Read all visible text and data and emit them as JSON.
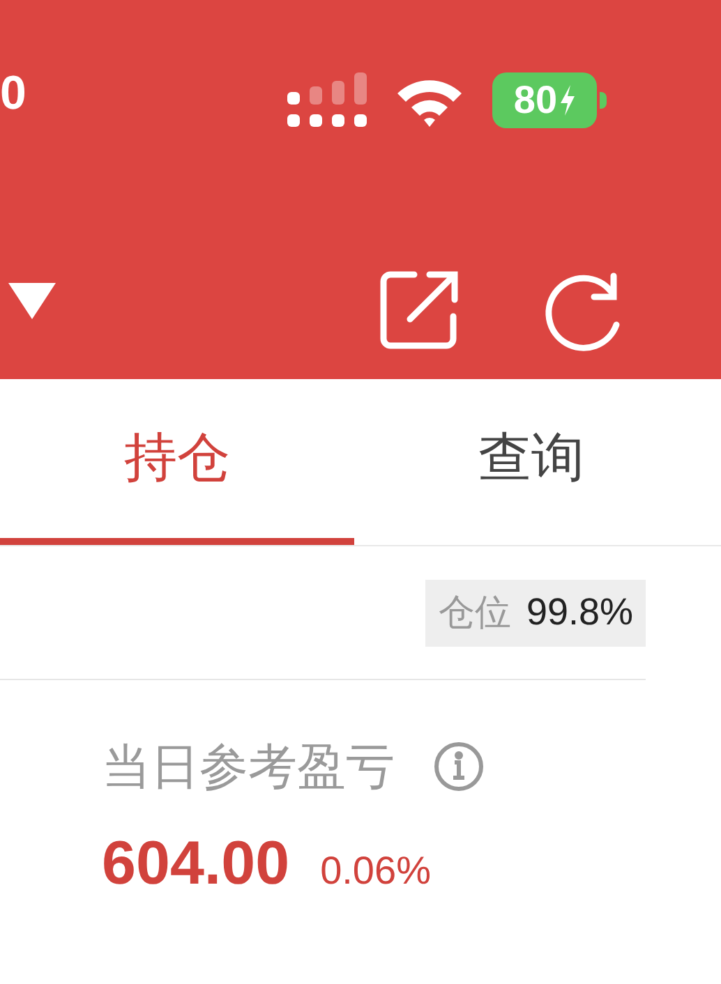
{
  "status_bar": {
    "time": "0",
    "battery": "80"
  },
  "tabs": [
    {
      "label": "持仓",
      "selected": true
    },
    {
      "label": "查询",
      "selected": false
    }
  ],
  "position": {
    "label": "仓位",
    "value": "99.8%"
  },
  "pnl": {
    "label": "当日参考盈亏",
    "value": "604.00",
    "percent": "0.06%"
  }
}
